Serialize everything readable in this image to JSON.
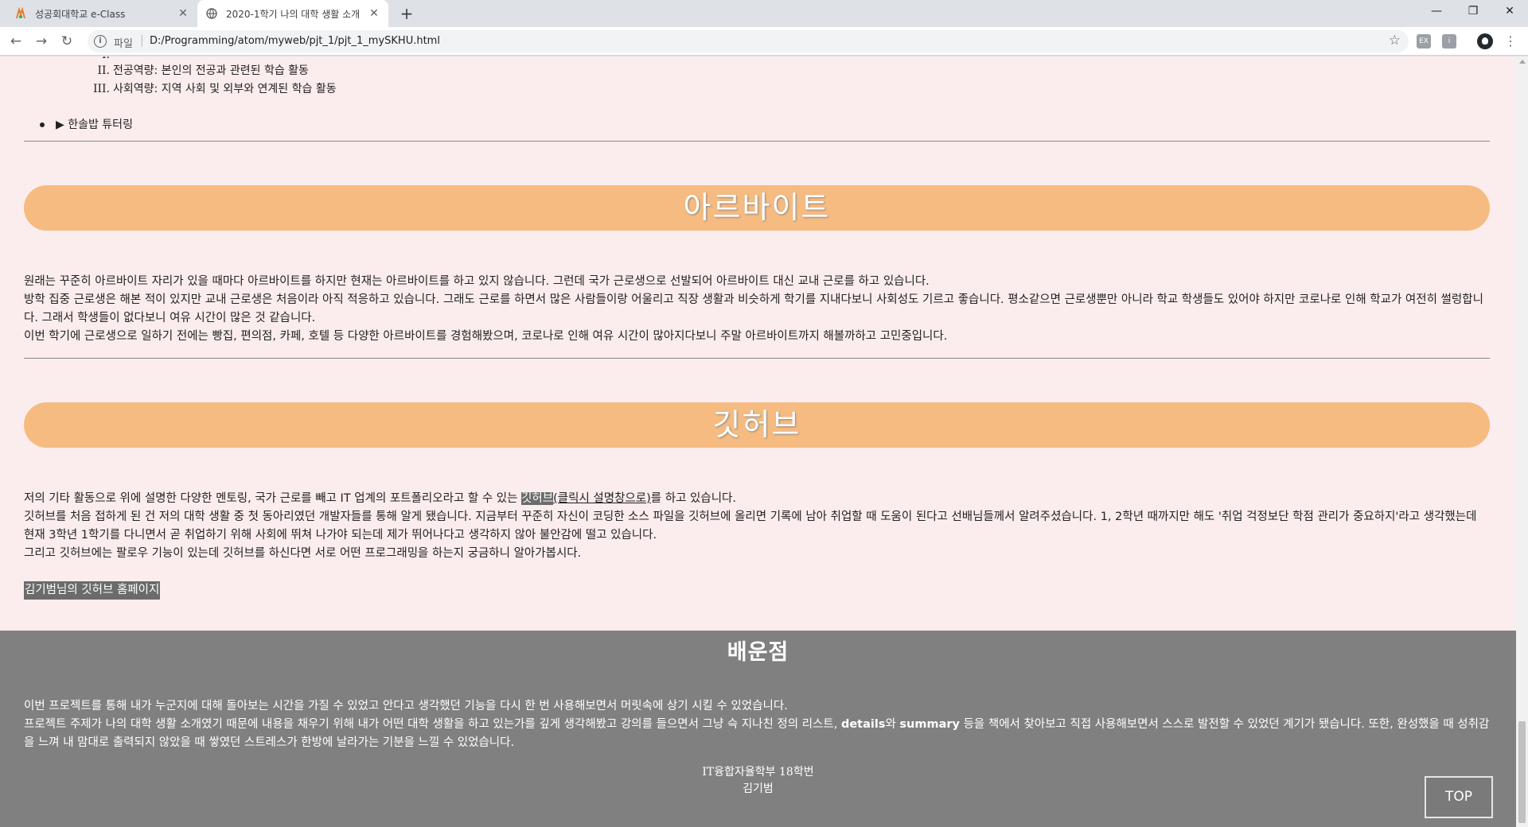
{
  "browser": {
    "tabs": [
      {
        "title": "성공회대학교 e-Class",
        "active": false
      },
      {
        "title": "2020-1학기 나의 대학 생활 소개",
        "active": true
      }
    ],
    "new_tab": "+",
    "window_controls": {
      "minimize": "—",
      "restore": "❐",
      "close": "✕"
    },
    "address": {
      "scheme": "파일",
      "url": "D:/Programming/atom/myweb/pjt_1/pjt_1_mySKHU.html"
    },
    "extensions": [
      "EX",
      "ⅰ"
    ]
  },
  "page": {
    "roman_list": [
      {
        "num": "II.",
        "text": "전공역량: 본인의 전공과 관련된 학습 활동"
      },
      {
        "num": "III.",
        "text": "사회역량: 지역 사회 및 외부와 연계된 학습 활동"
      }
    ],
    "details_summary": "▶ 한솔밥 튜터링",
    "arbeit": {
      "heading": "아르바이트",
      "lines": [
        "원래는 꾸준히 아르바이트 자리가 있을 때마다 아르바이트를 하지만 현재는 아르바이트를 하고 있지 않습니다. 그런데 국가 근로생으로 선발되어 아르바이트 대신 교내 근로를 하고 있습니다.",
        "방학 집중 근로생은 해본 적이 있지만 교내 근로생은 처음이라 아직 적응하고 있습니다. 그래도 근로를 하면서 많은 사람들이랑 어울리고 직장 생활과 비슷하게 학기를 지내다보니 사회성도 기르고 좋습니다. 평소같으면 근로생뿐만 아니라 학교 학생들도 있어야 하지만 코로나로 인해 학교가 여전히 썰렁합니다. 그래서 학생들이 없다보니 여유 시간이 많은 것 같습니다.",
        "이번 학기에 근로생으로 일하기 전에는 빵집, 편의점, 카페, 호텔 등 다양한 아르바이트를 경험해봤으며, 코로나로 인해 여유 시간이 많아지다보니 주말 아르바이트까지 해볼까하고 고민중입니다."
      ]
    },
    "github": {
      "heading": "깃허브",
      "line1_before": "저의 기타 활동으로 위에 설명한 다양한 멘토링, 국가 근로를 빼고 IT 업계의 포트폴리오라고 할 수 있는 ",
      "line1_highlight": "깃허브",
      "line1_link": "(클릭시 설명창으로)",
      "line1_after": "를 하고 있습니다.",
      "line2": "깃허브를 처음 접하게 된 건 저의 대학 생활 중 첫 동아리였던 개발자들를 통해 알게 됐습니다. 지금부터 꾸준히 자신이 코딩한 소스 파일을 깃허브에 올리면 기록에 남아 취업할 때 도움이 된다고 선배님들께서 알려주셨습니다. 1, 2학년 때까지만 해도 '취업 걱정보단 학점 관리가 중요하지'라고 생각했는데 현재 3학년 1학기를 다니면서 곧 취업하기 위해 사회에 뛰쳐 나가야 되는데 제가 뛰어나다고 생각하지 않아 불안감에 떨고 있습니다.",
      "line3": "그리고 깃허브에는 팔로우 기능이 있는데 깃허브를 하신다면 서로 어떤 프로그래밍을 하는지 궁금하니 알아가봅시다.",
      "homepage_link": "김기범님의 깃허브 홈페이지"
    },
    "footer": {
      "heading": "배운점",
      "line1": "이번 프로젝트를 통해 내가 누군지에 대해 돌아보는 시간을 가질 수 있었고 안다고 생각했던 기능을 다시 한 번 사용해보면서 머릿속에 상기 시킬 수 있었습니다.",
      "line2_a": "프로젝트 주제가 나의 대학 생활 소개였기 때문에 내용을 채우기 위해 내가 어떤 대학 생활을 하고 있는가를 깊게 생각해봤고 강의를 들으면서 그냥 슥 지나친 정의 리스트, ",
      "line2_details": "details",
      "line2_b": "와 ",
      "line2_summary": "summary",
      "line2_c": " 등을 책에서 찾아보고 직접 사용해보면서 스스로 발전할 수 있었던 계기가 됐습니다. 또한, 완성했을 때 성취감을 느껴 내 맘대로 출력되지 않았을 때 쌓였던 스트레스가 한방에 날라가는 기분을 느낄 수 있었습니다.",
      "credit_dept": "IT융합자율학부 18학번",
      "credit_name": "김기범"
    },
    "top_button": "TOP"
  }
}
